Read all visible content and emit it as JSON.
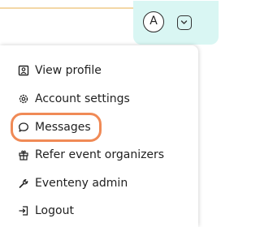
{
  "header": {
    "avatar_initial": "A"
  },
  "menu": {
    "items": [
      {
        "label": "View profile",
        "icon": "profile-card-icon"
      },
      {
        "label": "Account settings",
        "icon": "gear-icon"
      },
      {
        "label": "Messages",
        "icon": "speech-bubble-icon"
      },
      {
        "label": "Refer event organizers",
        "icon": "gift-icon"
      },
      {
        "label": "Eventeny admin",
        "icon": "wrench-icon"
      },
      {
        "label": "Logout",
        "icon": "logout-icon"
      }
    ],
    "highlighted_item": "Messages"
  },
  "colors": {
    "header_accent": "#d9f6f3",
    "highlight_outline": "#f08a56",
    "top_border": "#f3d7a6"
  }
}
